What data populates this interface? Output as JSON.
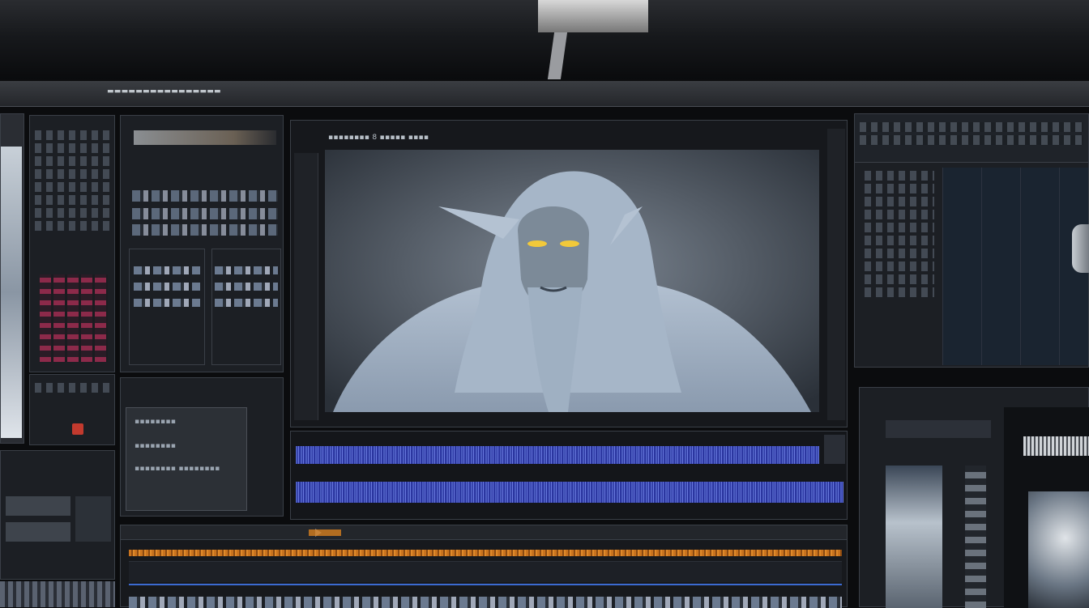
{
  "window": {
    "title": "▬▬▬▬▬▬▬▬▬▬▬▬▬▬▬▬"
  },
  "viewer": {
    "header_label": "▪▪▪▪▪▪▪▪ 8 ▪▪▪▪▪ ▪▪▪▪",
    "image_subject": "hooded-elder-creature-sculpt"
  },
  "left_lower_panel": {
    "lines": [
      "▪▪▪▪▪▪▪▪",
      "▪▪▪▪▪▪▪▪",
      "▪▪▪▪▪▪▪▪  ▪▪▪▪▪▪▪▪"
    ]
  },
  "colors": {
    "accent_blue": "#3b49b8",
    "accent_orange": "#d6801f",
    "accent_pink": "#8c2a4a",
    "panel_bg": "#1c1f24",
    "viewer_bg": "#56606c"
  },
  "icons": [
    "play-icon",
    "record-icon",
    "folder-icon",
    "grid-icon",
    "settings-icon"
  ]
}
